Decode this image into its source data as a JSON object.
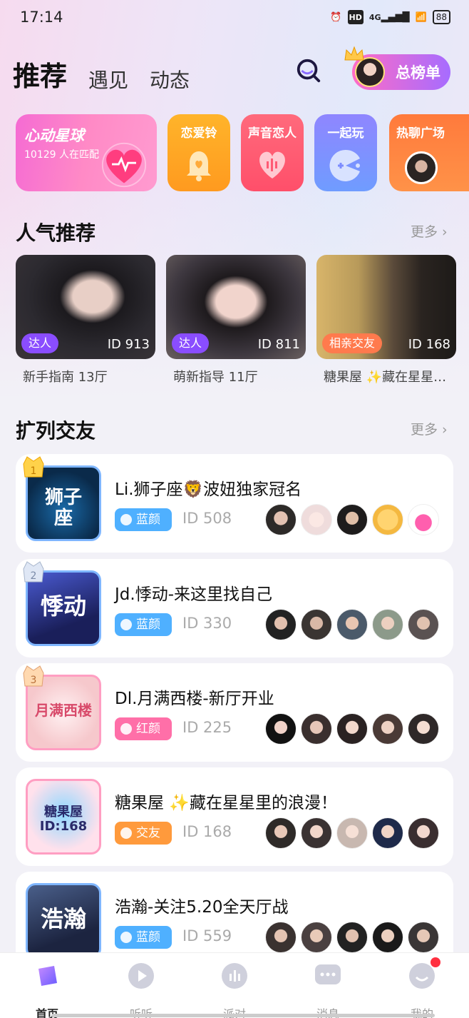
{
  "status": {
    "time": "17:14",
    "network": "4G",
    "hd": "HD",
    "battery": "88"
  },
  "top_tabs": [
    {
      "label": "推荐"
    },
    {
      "label": "遇见"
    },
    {
      "label": "动态"
    }
  ],
  "rank_button": "总榜单",
  "featured": {
    "main": {
      "title": "心动星球",
      "subtitle": "10129 人在匹配"
    },
    "items": [
      {
        "label": "恋爱铃"
      },
      {
        "label": "声音恋人"
      },
      {
        "label": "一起玩"
      },
      {
        "label": "热聊广场"
      }
    ]
  },
  "popular": {
    "title": "人气推荐",
    "more": "更多 ›",
    "cards": [
      {
        "badge": "达人",
        "id": "ID 913",
        "name": "新手指南  13厅",
        "badge_color": "#8a4dff"
      },
      {
        "badge": "达人",
        "id": "ID 811",
        "name": "萌新指导 11厅",
        "badge_color": "#8a4dff"
      },
      {
        "badge": "相亲交友",
        "id": "ID 168",
        "name": "糖果屋 ✨藏在星星里的浪漫！",
        "badge_color": "#ff7a4d"
      }
    ]
  },
  "rooms": {
    "title": "扩列交友",
    "more": "更多 ›",
    "items": [
      {
        "rank": "1",
        "thumb_text": "狮子座",
        "title": "Li.狮子座🦁波妞独家冠名",
        "tag": "蓝颜",
        "tag_color": "#4fb0ff",
        "id": "ID 508"
      },
      {
        "rank": "2",
        "thumb_text": "悸动",
        "title": "Jd.悸动-来这里找自己",
        "tag": "蓝颜",
        "tag_color": "#4fb0ff",
        "id": "ID 330"
      },
      {
        "rank": "3",
        "thumb_text": "月满西楼",
        "title": "Dl.月满西楼-新厅开业",
        "tag": "红颜",
        "tag_color": "#ff6fa8",
        "id": "ID 225"
      },
      {
        "rank": "",
        "thumb_text": "糖果屋 ID:168",
        "title": "糖果屋 ✨藏在星星里的浪漫！",
        "tag": "交友",
        "tag_color": "#ff9a3c",
        "id": "ID 168"
      },
      {
        "rank": "",
        "thumb_text": "浩瀚",
        "title": "浩瀚-关注5.20全天厅战",
        "tag": "蓝颜",
        "tag_color": "#4fb0ff",
        "id": "ID 559"
      }
    ]
  },
  "bottom_nav": [
    {
      "label": "首页"
    },
    {
      "label": "听听"
    },
    {
      "label": "派对"
    },
    {
      "label": "消息"
    },
    {
      "label": "我的"
    }
  ]
}
